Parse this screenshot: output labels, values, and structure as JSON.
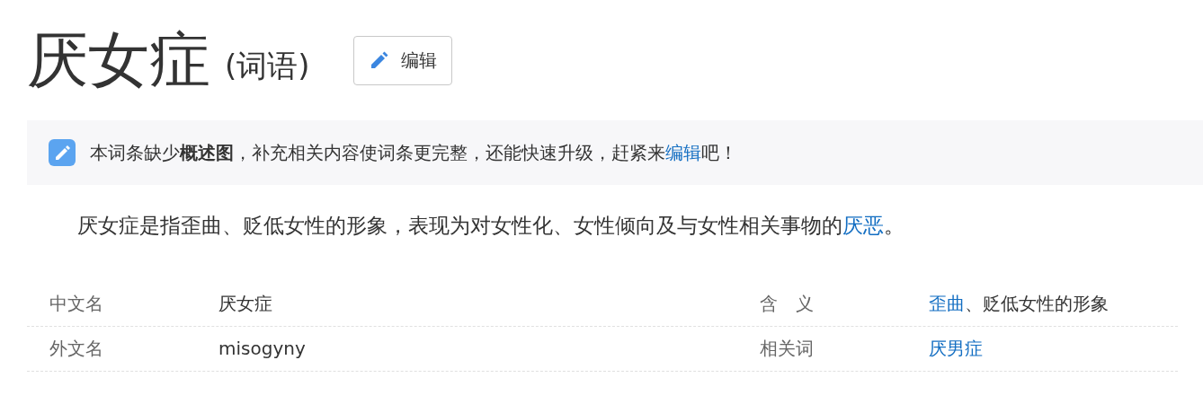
{
  "title": "厌女症",
  "subtitle": "(词语)",
  "edit_button": "编辑",
  "notice": {
    "text": "本词条缺少**概述图**，补充相关内容使词条更完整，还能快速升级，赶紧来",
    "link": "编辑",
    "suffix": "吧！"
  },
  "summary": {
    "text": "厌女症是指歪曲、贬低女性的形象，表现为对女性化、女性倾向及与女性相关事物的",
    "link": "厌恶",
    "suffix": "。"
  },
  "info_rows": [
    {
      "label": "中文名",
      "value": [
        {
          "text": "厌女症",
          "link": false
        }
      ],
      "label_2": "含　义",
      "value_2": [
        {
          "text": "歪曲",
          "link": true
        },
        {
          "text": "、贬低女性的形象",
          "link": false
        }
      ]
    },
    {
      "label": "外文名",
      "value": [
        {
          "text": "misogyny",
          "link": false
        }
      ],
      "label_2": "相关词",
      "value_2": [
        {
          "text": "厌男症",
          "link": true
        }
      ]
    }
  ]
}
